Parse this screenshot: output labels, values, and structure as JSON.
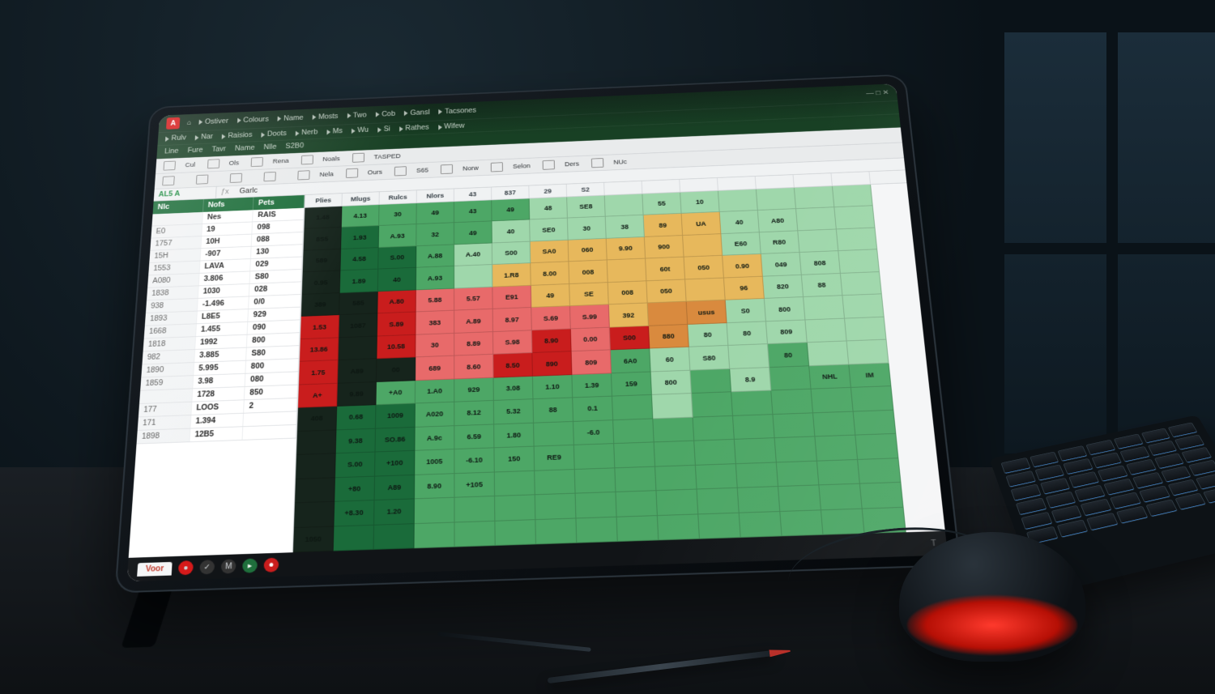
{
  "app_badge": "A",
  "menu1": [
    "Ostiver",
    "Colours",
    "Name",
    "Mosts",
    "Two",
    "Cob",
    "Gansl",
    "Tacsones"
  ],
  "menu2": [
    "Rulv",
    "Nar",
    "Raisios",
    "Doots",
    "Nerb",
    "Ms",
    "Wu",
    "Si",
    "Rathes",
    "Wifew"
  ],
  "menu3": [
    "Line",
    "Fure",
    "Tavr",
    "Name",
    "Nlle",
    "S2B0"
  ],
  "ribbon_light_a": [
    "Cul",
    "Ols",
    "Rena",
    "Noals",
    "TASPED"
  ],
  "ribbon_light_b": [
    "",
    "",
    "",
    "",
    "Nela",
    "Ours",
    "S65",
    "Norw",
    "Selon",
    "Ders",
    "NUc"
  ],
  "namebox": "AL5  A",
  "formula": "Garlc",
  "left_headers": [
    "Nlc",
    "Nofs",
    "Pets"
  ],
  "left_rows": [
    [
      "",
      "Nes",
      "RAIS"
    ],
    [
      "E0",
      "19",
      "098"
    ],
    [
      "1757",
      "10H",
      "088"
    ],
    [
      "15H",
      "-907",
      "130"
    ],
    [
      "1553",
      "LAVA",
      "029"
    ],
    [
      "A080",
      "3.806",
      "S80"
    ],
    [
      "1838",
      "1030",
      "028"
    ],
    [
      "938",
      "-1.496",
      "0/0"
    ],
    [
      "1893",
      "L8E5",
      "929"
    ],
    [
      "1668",
      "1.455",
      "090"
    ],
    [
      "1818",
      "1992",
      "800"
    ],
    [
      "982",
      "3.885",
      "S80"
    ],
    [
      "1890",
      "5.995",
      "800"
    ],
    [
      "1859",
      "3.98",
      "080"
    ],
    [
      "",
      "1728",
      "850"
    ],
    [
      "177",
      "LOOS",
      "2"
    ],
    [
      "171",
      "1.394",
      ""
    ],
    [
      "1898",
      "12B5",
      ""
    ]
  ],
  "heat_headers": [
    "Plies",
    "Mlugs",
    "Rulcs",
    "Nlors",
    "43",
    "837",
    "29",
    "S2",
    "",
    "",
    "",
    "",
    "",
    "",
    ""
  ],
  "chart_data": {
    "type": "heatmap",
    "color_scale": {
      "dg": "#1a6b3a",
      "g": "#4da766",
      "lg": "#9fd7ab",
      "y": "#e7b85c",
      "o": "#d98a3e",
      "lr": "#e86a6a",
      "r": "#c91d1d",
      "dk": "#16241c"
    },
    "rows": [
      [
        {
          "v": "1.48",
          "c": "dk"
        },
        {
          "v": "4.13",
          "c": "g"
        },
        {
          "v": "30",
          "c": "g"
        },
        {
          "v": "49",
          "c": "g"
        },
        {
          "v": "43",
          "c": "g"
        },
        {
          "v": "49",
          "c": "g"
        },
        {
          "v": "48",
          "c": "lg"
        },
        {
          "v": "SE8",
          "c": "lg"
        },
        {
          "v": "",
          "c": "lg"
        },
        {
          "v": "55",
          "c": "lg"
        },
        {
          "v": "10",
          "c": "lg"
        },
        {
          "v": "",
          "c": "lg"
        },
        {
          "v": "",
          "c": "lg"
        },
        {
          "v": "",
          "c": "lg"
        },
        {
          "v": "",
          "c": "lg"
        }
      ],
      [
        {
          "v": "8S5",
          "c": "dk"
        },
        {
          "v": "1.93",
          "c": "dg"
        },
        {
          "v": "A.93",
          "c": "g"
        },
        {
          "v": "32",
          "c": "g"
        },
        {
          "v": "49",
          "c": "g"
        },
        {
          "v": "40",
          "c": "lg"
        },
        {
          "v": "SE0",
          "c": "lg"
        },
        {
          "v": "30",
          "c": "lg"
        },
        {
          "v": "38",
          "c": "lg"
        },
        {
          "v": "89",
          "c": "y"
        },
        {
          "v": "UA",
          "c": "y"
        },
        {
          "v": "40",
          "c": "lg"
        },
        {
          "v": "A80",
          "c": "lg"
        },
        {
          "v": "",
          "c": "lg"
        },
        {
          "v": "",
          "c": "lg"
        }
      ],
      [
        {
          "v": "589",
          "c": "dk"
        },
        {
          "v": "4.58",
          "c": "dg"
        },
        {
          "v": "S.00",
          "c": "dg"
        },
        {
          "v": "A.88",
          "c": "g"
        },
        {
          "v": "A.40",
          "c": "lg"
        },
        {
          "v": "S00",
          "c": "lg"
        },
        {
          "v": "SA0",
          "c": "y"
        },
        {
          "v": "060",
          "c": "y"
        },
        {
          "v": "9.90",
          "c": "y"
        },
        {
          "v": "900",
          "c": "y"
        },
        {
          "v": "",
          "c": "y"
        },
        {
          "v": "E60",
          "c": "lg"
        },
        {
          "v": "R80",
          "c": "lg"
        },
        {
          "v": "",
          "c": "lg"
        },
        {
          "v": "",
          "c": "lg"
        }
      ],
      [
        {
          "v": "0.95",
          "c": "dk"
        },
        {
          "v": "1.89",
          "c": "dg"
        },
        {
          "v": "40",
          "c": "dg"
        },
        {
          "v": "A.93",
          "c": "g"
        },
        {
          "v": "",
          "c": "lg"
        },
        {
          "v": "1.R8",
          "c": "y"
        },
        {
          "v": "8.00",
          "c": "y"
        },
        {
          "v": "008",
          "c": "y"
        },
        {
          "v": "",
          "c": "y"
        },
        {
          "v": "60t",
          "c": "y"
        },
        {
          "v": "050",
          "c": "y"
        },
        {
          "v": "0.90",
          "c": "y"
        },
        {
          "v": "049",
          "c": "lg"
        },
        {
          "v": "808",
          "c": "lg"
        },
        {
          "v": "",
          "c": "lg"
        }
      ],
      [
        {
          "v": "389",
          "c": "dk"
        },
        {
          "v": "585",
          "c": "dk"
        },
        {
          "v": "A.80",
          "c": "r"
        },
        {
          "v": "5.88",
          "c": "lr"
        },
        {
          "v": "5.57",
          "c": "lr"
        },
        {
          "v": "E91",
          "c": "lr"
        },
        {
          "v": "49",
          "c": "y"
        },
        {
          "v": "SE",
          "c": "y"
        },
        {
          "v": "008",
          "c": "y"
        },
        {
          "v": "050",
          "c": "y"
        },
        {
          "v": "",
          "c": "y"
        },
        {
          "v": "96",
          "c": "y"
        },
        {
          "v": "820",
          "c": "lg"
        },
        {
          "v": "88",
          "c": "lg"
        },
        {
          "v": "",
          "c": "lg"
        }
      ],
      [
        {
          "v": "1.53",
          "c": "r"
        },
        {
          "v": "1087",
          "c": "dk"
        },
        {
          "v": "S.89",
          "c": "r"
        },
        {
          "v": "383",
          "c": "lr"
        },
        {
          "v": "A.89",
          "c": "lr"
        },
        {
          "v": "8.97",
          "c": "lr"
        },
        {
          "v": "S.69",
          "c": "lr"
        },
        {
          "v": "S.99",
          "c": "lr"
        },
        {
          "v": "392",
          "c": "y"
        },
        {
          "v": "",
          "c": "o"
        },
        {
          "v": "usus",
          "c": "o"
        },
        {
          "v": "S0",
          "c": "lg"
        },
        {
          "v": "800",
          "c": "lg"
        },
        {
          "v": "",
          "c": "lg"
        },
        {
          "v": "",
          "c": "lg"
        }
      ],
      [
        {
          "v": "13.86",
          "c": "r"
        },
        {
          "v": "",
          "c": "dk"
        },
        {
          "v": "10.58",
          "c": "r"
        },
        {
          "v": "30",
          "c": "lr"
        },
        {
          "v": "8.89",
          "c": "lr"
        },
        {
          "v": "S.98",
          "c": "lr"
        },
        {
          "v": "8.90",
          "c": "r"
        },
        {
          "v": "0.00",
          "c": "lr"
        },
        {
          "v": "S00",
          "c": "r"
        },
        {
          "v": "880",
          "c": "o"
        },
        {
          "v": "80",
          "c": "lg"
        },
        {
          "v": "80",
          "c": "lg"
        },
        {
          "v": "809",
          "c": "lg"
        },
        {
          "v": "",
          "c": "lg"
        },
        {
          "v": "",
          "c": "lg"
        }
      ],
      [
        {
          "v": "1.75",
          "c": "r"
        },
        {
          "v": "A89",
          "c": "dk"
        },
        {
          "v": "00",
          "c": "dk"
        },
        {
          "v": "689",
          "c": "lr"
        },
        {
          "v": "8.60",
          "c": "lr"
        },
        {
          "v": "8.50",
          "c": "r"
        },
        {
          "v": "890",
          "c": "r"
        },
        {
          "v": "809",
          "c": "lr"
        },
        {
          "v": "6A0",
          "c": "g"
        },
        {
          "v": "60",
          "c": "lg"
        },
        {
          "v": "S80",
          "c": "lg"
        },
        {
          "v": "",
          "c": "lg"
        },
        {
          "v": "80",
          "c": "g"
        },
        {
          "v": "",
          "c": "lg"
        },
        {
          "v": "",
          "c": "lg"
        }
      ],
      [
        {
          "v": "A+",
          "c": "r"
        },
        {
          "v": "9.89",
          "c": "dk"
        },
        {
          "v": "+A0",
          "c": "g"
        },
        {
          "v": "1.A0",
          "c": "g"
        },
        {
          "v": "929",
          "c": "g"
        },
        {
          "v": "3.08",
          "c": "g"
        },
        {
          "v": "1.10",
          "c": "g"
        },
        {
          "v": "1.39",
          "c": "g"
        },
        {
          "v": "159",
          "c": "g"
        },
        {
          "v": "800",
          "c": "lg"
        },
        {
          "v": "",
          "c": "g"
        },
        {
          "v": "8.9",
          "c": "lg"
        },
        {
          "v": "",
          "c": "g"
        },
        {
          "v": "NHL",
          "c": "g"
        },
        {
          "v": "IM",
          "c": "g"
        }
      ],
      [
        {
          "v": "408",
          "c": "dk"
        },
        {
          "v": "0.68",
          "c": "dg"
        },
        {
          "v": "1009",
          "c": "dg"
        },
        {
          "v": "A020",
          "c": "g"
        },
        {
          "v": "8.12",
          "c": "g"
        },
        {
          "v": "5.32",
          "c": "g"
        },
        {
          "v": "88",
          "c": "g"
        },
        {
          "v": "0.1",
          "c": "g"
        },
        {
          "v": "",
          "c": "g"
        },
        {
          "v": "",
          "c": "lg"
        },
        {
          "v": "",
          "c": "g"
        },
        {
          "v": "",
          "c": "g"
        },
        {
          "v": "",
          "c": "g"
        },
        {
          "v": "",
          "c": "g"
        },
        {
          "v": "",
          "c": "g"
        }
      ],
      [
        {
          "v": "",
          "c": "dk"
        },
        {
          "v": "9.38",
          "c": "dg"
        },
        {
          "v": "SO.86",
          "c": "dg"
        },
        {
          "v": "A.9c",
          "c": "g"
        },
        {
          "v": "6.59",
          "c": "g"
        },
        {
          "v": "1.80",
          "c": "g"
        },
        {
          "v": "",
          "c": "g"
        },
        {
          "v": "-6.0",
          "c": "g"
        },
        {
          "v": "",
          "c": "g"
        },
        {
          "v": "",
          "c": "g"
        },
        {
          "v": "",
          "c": "g"
        },
        {
          "v": "",
          "c": "g"
        },
        {
          "v": "",
          "c": "g"
        },
        {
          "v": "",
          "c": "g"
        },
        {
          "v": "",
          "c": "g"
        }
      ],
      [
        {
          "v": "",
          "c": "dk"
        },
        {
          "v": "S.00",
          "c": "dg"
        },
        {
          "v": "+100",
          "c": "dg"
        },
        {
          "v": "1005",
          "c": "g"
        },
        {
          "v": "-6.10",
          "c": "g"
        },
        {
          "v": "150",
          "c": "g"
        },
        {
          "v": "RE9",
          "c": "g"
        },
        {
          "v": "",
          "c": "g"
        },
        {
          "v": "",
          "c": "g"
        },
        {
          "v": "",
          "c": "g"
        },
        {
          "v": "",
          "c": "g"
        },
        {
          "v": "",
          "c": "g"
        },
        {
          "v": "",
          "c": "g"
        },
        {
          "v": "",
          "c": "g"
        },
        {
          "v": "",
          "c": "g"
        }
      ],
      [
        {
          "v": "",
          "c": "dk"
        },
        {
          "v": "+80",
          "c": "dg"
        },
        {
          "v": "A89",
          "c": "dg"
        },
        {
          "v": "8.90",
          "c": "g"
        },
        {
          "v": "+105",
          "c": "g"
        },
        {
          "v": "",
          "c": "g"
        },
        {
          "v": "",
          "c": "g"
        },
        {
          "v": "",
          "c": "g"
        },
        {
          "v": "",
          "c": "g"
        },
        {
          "v": "",
          "c": "g"
        },
        {
          "v": "",
          "c": "g"
        },
        {
          "v": "",
          "c": "g"
        },
        {
          "v": "",
          "c": "g"
        },
        {
          "v": "",
          "c": "g"
        },
        {
          "v": "",
          "c": "g"
        }
      ],
      [
        {
          "v": "",
          "c": "dk"
        },
        {
          "v": "+8.30",
          "c": "dg"
        },
        {
          "v": "1.20",
          "c": "dg"
        },
        {
          "v": "",
          "c": "g"
        },
        {
          "v": "",
          "c": "g"
        },
        {
          "v": "",
          "c": "g"
        },
        {
          "v": "",
          "c": "g"
        },
        {
          "v": "",
          "c": "g"
        },
        {
          "v": "",
          "c": "g"
        },
        {
          "v": "",
          "c": "g"
        },
        {
          "v": "",
          "c": "g"
        },
        {
          "v": "",
          "c": "g"
        },
        {
          "v": "",
          "c": "g"
        },
        {
          "v": "",
          "c": "g"
        },
        {
          "v": "",
          "c": "g"
        }
      ],
      [
        {
          "v": "1050",
          "c": "dk"
        },
        {
          "v": "",
          "c": "dg"
        },
        {
          "v": "",
          "c": "dg"
        },
        {
          "v": "",
          "c": "g"
        },
        {
          "v": "",
          "c": "g"
        },
        {
          "v": "",
          "c": "g"
        },
        {
          "v": "",
          "c": "g"
        },
        {
          "v": "",
          "c": "g"
        },
        {
          "v": "",
          "c": "g"
        },
        {
          "v": "",
          "c": "g"
        },
        {
          "v": "",
          "c": "g"
        },
        {
          "v": "",
          "c": "g"
        },
        {
          "v": "",
          "c": "g"
        },
        {
          "v": "",
          "c": "g"
        },
        {
          "v": "",
          "c": "g"
        }
      ]
    ]
  },
  "status": {
    "tab": "Voor",
    "caption": "T"
  }
}
